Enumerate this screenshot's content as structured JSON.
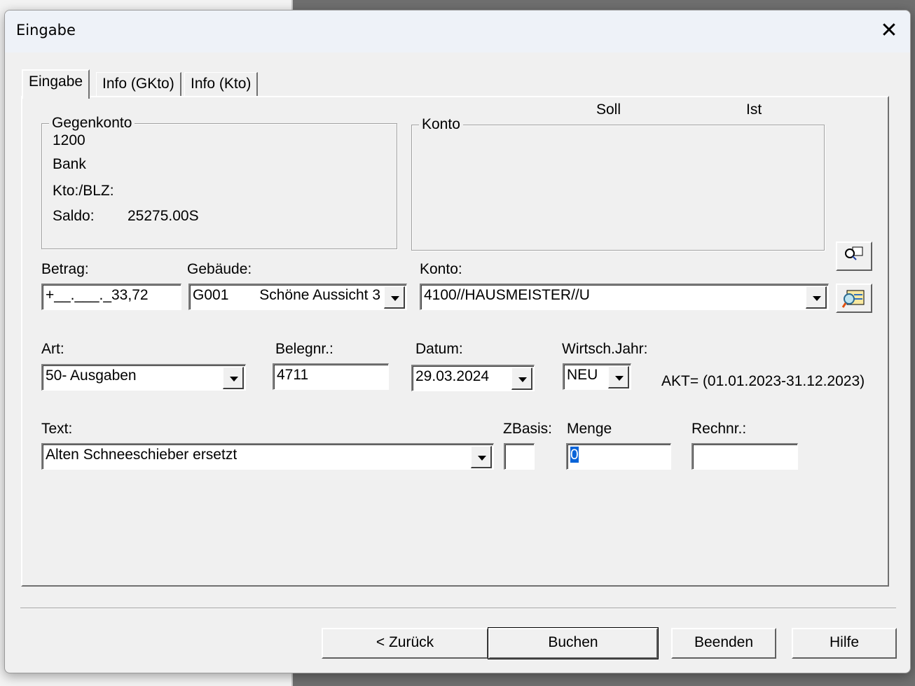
{
  "window": {
    "title": "Eingabe",
    "close_icon": "close-icon"
  },
  "tabs": [
    {
      "label": "Eingabe",
      "active": true
    },
    {
      "label": "Info (GKto)"
    },
    {
      "label": "Info (Kto)"
    }
  ],
  "gegenkonto": {
    "legend": "Gegenkonto",
    "number": "1200",
    "name": "Bank",
    "kto_blz_label": "Kto:/BLZ:",
    "saldo_label": "Saldo:",
    "saldo_value": "25275.00S"
  },
  "konto_group": {
    "legend": "Konto",
    "soll_label": "Soll",
    "ist_label": "Ist"
  },
  "fields": {
    "betrag": {
      "label": "Betrag:",
      "value": "+__.___._33,72"
    },
    "gebaeude": {
      "label": "Gebäude:",
      "code": "G001",
      "value": "Schöne Aussicht 3"
    },
    "konto": {
      "label": "Konto:",
      "value": "4100//HAUSMEISTER//U"
    },
    "art": {
      "label": "Art:",
      "value": "50- Ausgaben"
    },
    "belegnr": {
      "label": "Belegnr.:",
      "value": "4711"
    },
    "datum": {
      "label": "Datum:",
      "value": "29.03.2024"
    },
    "wirtschjahr": {
      "label": "Wirtsch.Jahr:",
      "value": "NEU"
    },
    "akt": "AKT= (01.01.2023-31.12.2023)",
    "text": {
      "label": "Text:",
      "value": "Alten Schneeschieber ersetzt"
    },
    "zbasis": {
      "label": "ZBasis:",
      "value": ""
    },
    "menge": {
      "label": "Menge",
      "value": "0"
    },
    "rechnr": {
      "label": "Rechnr.:",
      "value": ""
    }
  },
  "buttons": {
    "back": "< Zurück",
    "book": "Buchen",
    "exit": "Beenden",
    "help": "Hilfe"
  }
}
